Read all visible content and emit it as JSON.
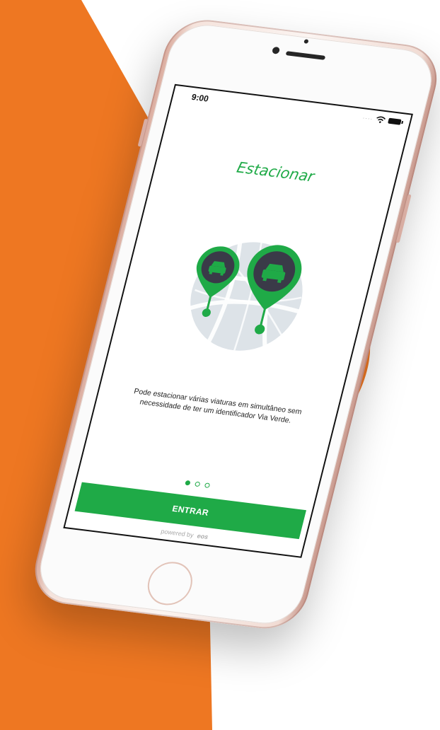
{
  "status_bar": {
    "time": "9:00",
    "signal_icon": "signal-dots-icon",
    "wifi_icon": "wifi-icon",
    "battery_icon": "battery-icon"
  },
  "onboarding": {
    "title": "Estacionar",
    "illustration_icon": "parking-location-pins-icon",
    "description": "Pode estacionar várias viaturas em simultâneo sem necessidade de ter um identificador Via Verde.",
    "pager": {
      "total": 3,
      "active_index": 0
    },
    "enter_button_label": "ENTRAR",
    "powered_by_label": "powered by",
    "powered_by_brand": "eos"
  },
  "colors": {
    "accent": "#1faa47",
    "background_shape": "#ee7722",
    "pin_dark": "#3a3a48"
  }
}
